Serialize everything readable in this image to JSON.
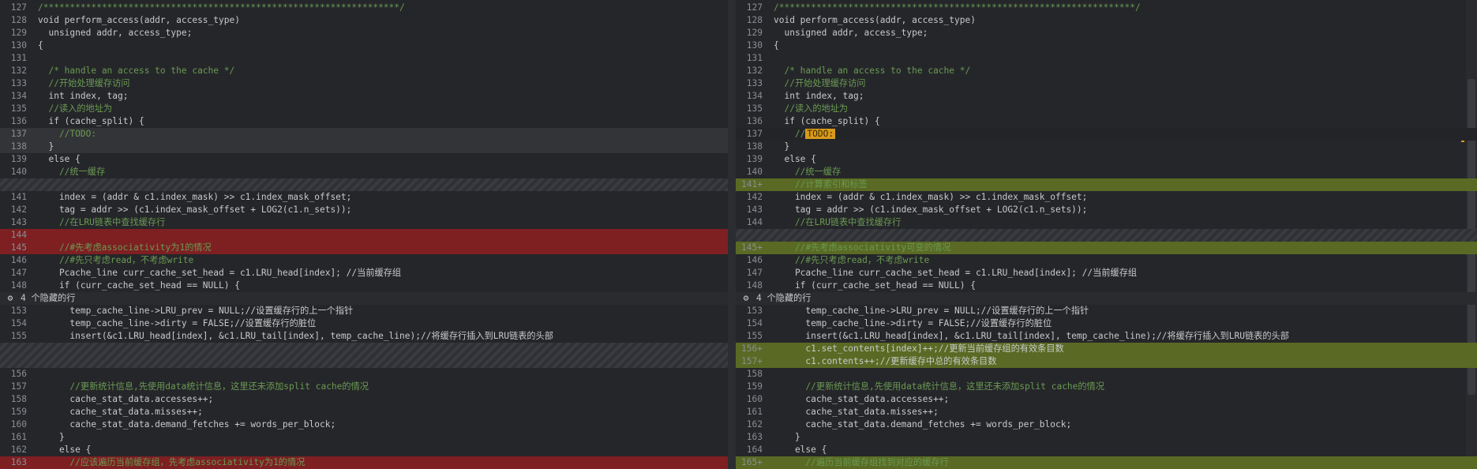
{
  "separator_text": "4 个隐藏的行",
  "left": {
    "lines_top": [
      {
        "n": "127",
        "t": "/*******************************************************************/",
        "cls": "cm",
        "hl": ""
      },
      {
        "n": "128",
        "t": "void perform_access(addr, access_type)",
        "cls": "",
        "hl": ""
      },
      {
        "n": "129",
        "t": "  unsigned addr, access_type;",
        "cls": "",
        "hl": ""
      },
      {
        "n": "130",
        "t": "{",
        "cls": "",
        "hl": ""
      },
      {
        "n": "131",
        "t": "",
        "cls": "",
        "hl": ""
      },
      {
        "n": "132",
        "t": "  /* handle an access to the cache */",
        "cls": "cm",
        "hl": ""
      },
      {
        "n": "133",
        "t": "  //开始处理缓存访问",
        "cls": "cm",
        "hl": ""
      },
      {
        "n": "134",
        "t": "  int index, tag;",
        "cls": "",
        "hl": ""
      },
      {
        "n": "135",
        "t": "  //读入的地址为",
        "cls": "cm",
        "hl": ""
      },
      {
        "n": "136",
        "t": "  if (cache_split) {",
        "cls": "",
        "hl": ""
      },
      {
        "n": "137",
        "t": "    //TODO:",
        "cls": "cm",
        "hl": "hl-mod"
      },
      {
        "n": "138",
        "t": "  }",
        "cls": "",
        "hl": "hl-mod"
      },
      {
        "n": "139",
        "t": "  else {",
        "cls": "",
        "hl": ""
      },
      {
        "n": "140",
        "t": "    //统一缓存",
        "cls": "cm",
        "hl": ""
      }
    ],
    "lines_mid": [
      {
        "n": "141",
        "t": "    index = (addr & c1.index_mask) >> c1.index_mask_offset;",
        "cls": "",
        "hl": ""
      },
      {
        "n": "142",
        "t": "    tag = addr >> (c1.index_mask_offset + LOG2(c1.n_sets));",
        "cls": "",
        "hl": ""
      },
      {
        "n": "143",
        "t": "    //在LRU链表中查找缓存行",
        "cls": "cm",
        "hl": ""
      },
      {
        "n": "144",
        "t": "",
        "cls": "",
        "hl": "hl-del"
      },
      {
        "n": "145",
        "t": "    //#先考虑associativity为1的情况",
        "cls": "cm",
        "hl": "hl-del"
      },
      {
        "n": "146",
        "t": "    //#先只考虑read，不考虑write",
        "cls": "cm",
        "hl": ""
      },
      {
        "n": "147",
        "t": "    Pcache_line curr_cache_set_head = c1.LRU_head[index]; //当前缓存组",
        "cls": "",
        "hl": ""
      },
      {
        "n": "148",
        "t": "    if (curr_cache_set_head == NULL) {",
        "cls": "",
        "hl": ""
      }
    ],
    "lines_after": [
      {
        "n": "153",
        "t": "      temp_cache_line->LRU_prev = NULL;//设置缓存行的上一个指针",
        "cls": "",
        "hl": ""
      },
      {
        "n": "154",
        "t": "      temp_cache_line->dirty = FALSE;//设置缓存行的脏位",
        "cls": "",
        "hl": ""
      },
      {
        "n": "155",
        "t": "      insert(&c1.LRU_head[index], &c1.LRU_tail[index], temp_cache_line);//将缓存行插入到LRU链表的头部",
        "cls": "",
        "hl": ""
      }
    ],
    "lines_bottom": [
      {
        "n": "156",
        "t": "",
        "cls": "",
        "hl": ""
      },
      {
        "n": "157",
        "t": "      //更新统计信息,先使用data统计信息，这里还未添加split cache的情况",
        "cls": "cm",
        "hl": ""
      },
      {
        "n": "158",
        "t": "      cache_stat_data.accesses++;",
        "cls": "",
        "hl": ""
      },
      {
        "n": "159",
        "t": "      cache_stat_data.misses++;",
        "cls": "",
        "hl": ""
      },
      {
        "n": "160",
        "t": "      cache_stat_data.demand_fetches += words_per_block;",
        "cls": "",
        "hl": ""
      },
      {
        "n": "161",
        "t": "    }",
        "cls": "",
        "hl": ""
      },
      {
        "n": "162",
        "t": "    else {",
        "cls": "",
        "hl": ""
      },
      {
        "n": "163",
        "t": "      //应该遍历当前缓存组，先考虑associativity为1的情况",
        "cls": "cm",
        "hl": "hl-del"
      }
    ]
  },
  "right": {
    "lines_top": [
      {
        "n": "127",
        "t": "/*******************************************************************/",
        "cls": "cm",
        "hl": ""
      },
      {
        "n": "128",
        "t": "void perform_access(addr, access_type)",
        "cls": "",
        "hl": ""
      },
      {
        "n": "129",
        "t": "  unsigned addr, access_type;",
        "cls": "",
        "hl": ""
      },
      {
        "n": "130",
        "t": "{",
        "cls": "",
        "hl": ""
      },
      {
        "n": "131",
        "t": "",
        "cls": "",
        "hl": ""
      },
      {
        "n": "132",
        "t": "  /* handle an access to the cache */",
        "cls": "cm",
        "hl": ""
      },
      {
        "n": "133",
        "t": "  //开始处理缓存访问",
        "cls": "cm",
        "hl": ""
      },
      {
        "n": "134",
        "t": "  int index, tag;",
        "cls": "",
        "hl": ""
      },
      {
        "n": "135",
        "t": "  //读入的地址为",
        "cls": "cm",
        "hl": ""
      },
      {
        "n": "136",
        "t": "  if (cache_split) {",
        "cls": "",
        "hl": ""
      },
      {
        "n": "137",
        "t": "    //",
        "cls": "cm",
        "hl": "hl-cur",
        "todo": "TODO:"
      },
      {
        "n": "138",
        "t": "  }",
        "cls": "",
        "hl": ""
      },
      {
        "n": "139",
        "t": "  else {",
        "cls": "",
        "hl": ""
      },
      {
        "n": "140",
        "t": "    //统一缓存",
        "cls": "cm",
        "hl": ""
      },
      {
        "n": "141+",
        "t": "    //计算索引和标签",
        "cls": "cm",
        "hl": "hl-add"
      },
      {
        "n": "142",
        "t": "    index = (addr & c1.index_mask) >> c1.index_mask_offset;",
        "cls": "",
        "hl": ""
      },
      {
        "n": "143",
        "t": "    tag = addr >> (c1.index_mask_offset + LOG2(c1.n_sets));",
        "cls": "",
        "hl": ""
      },
      {
        "n": "144",
        "t": "    //在LRU链表中查找缓存行",
        "cls": "cm",
        "hl": ""
      }
    ],
    "lines_mid": [
      {
        "n": "145+",
        "t": "    //#先考虑associativity可变的情况",
        "cls": "cm",
        "hl": "hl-add"
      },
      {
        "n": "146",
        "t": "    //#先只考虑read，不考虑write",
        "cls": "cm",
        "hl": ""
      },
      {
        "n": "147",
        "t": "    Pcache_line curr_cache_set_head = c1.LRU_head[index]; //当前缓存组",
        "cls": "",
        "hl": ""
      },
      {
        "n": "148",
        "t": "    if (curr_cache_set_head == NULL) {",
        "cls": "",
        "hl": ""
      }
    ],
    "lines_after": [
      {
        "n": "153",
        "t": "      temp_cache_line->LRU_prev = NULL;//设置缓存行的上一个指针",
        "cls": "",
        "hl": ""
      },
      {
        "n": "154",
        "t": "      temp_cache_line->dirty = FALSE;//设置缓存行的脏位",
        "cls": "",
        "hl": ""
      },
      {
        "n": "155",
        "t": "      insert(&c1.LRU_head[index], &c1.LRU_tail[index], temp_cache_line);//将缓存行插入到LRU链表的头部",
        "cls": "",
        "hl": ""
      },
      {
        "n": "156+",
        "t": "      c1.set_contents[index]++;//更新当前缓存组的有效条目数",
        "cls": "",
        "hl": "hl-add"
      },
      {
        "n": "157+",
        "t": "      c1.contents++;//更新缓存中总的有效条目数",
        "cls": "",
        "hl": "hl-add"
      },
      {
        "n": "158",
        "t": "",
        "cls": "",
        "hl": ""
      },
      {
        "n": "159",
        "t": "      //更新统计信息,先使用data统计信息，这里还未添加split cache的情况",
        "cls": "cm",
        "hl": ""
      },
      {
        "n": "160",
        "t": "      cache_stat_data.accesses++;",
        "cls": "",
        "hl": ""
      },
      {
        "n": "161",
        "t": "      cache_stat_data.misses++;",
        "cls": "",
        "hl": ""
      },
      {
        "n": "162",
        "t": "      cache_stat_data.demand_fetches += words_per_block;",
        "cls": "",
        "hl": ""
      },
      {
        "n": "163",
        "t": "    }",
        "cls": "",
        "hl": ""
      },
      {
        "n": "164",
        "t": "    else {",
        "cls": "",
        "hl": ""
      },
      {
        "n": "165+",
        "t": "      //遍历当前缓存组找到对应的缓存行",
        "cls": "cm",
        "hl": "hl-add"
      }
    ]
  }
}
